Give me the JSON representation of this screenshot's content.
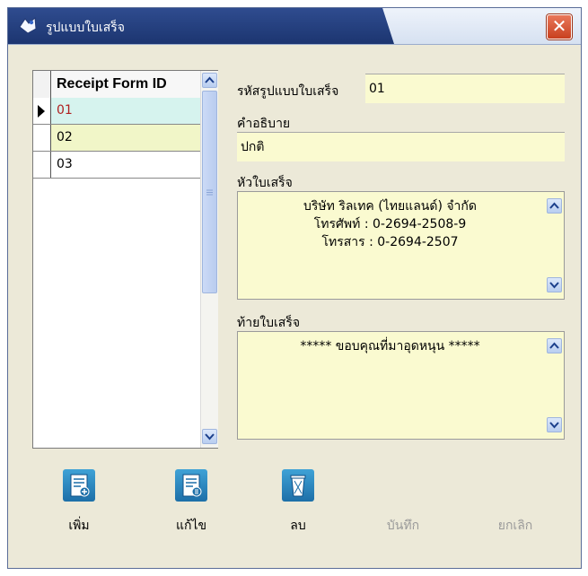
{
  "window": {
    "title": "รูปแบบใบเสร็จ"
  },
  "grid": {
    "header": "Receipt Form ID",
    "rows": [
      "01",
      "02",
      "03"
    ],
    "selected_index": 0
  },
  "form": {
    "code_label": "รหัสรูปแบบใบเสร็จ",
    "code_value": "01",
    "desc_label": "คำอธิบาย",
    "desc_value": "ปกติ",
    "header_label": "หัวใบเสร็จ",
    "header_text": "บริษัท ริลเทค (ไทยแลนด์) จำกัด\nโทรศัพท์ : 0-2694-2508-9\nโทรสาร : 0-2694-2507",
    "footer_label": "ท้ายใบเสร็จ",
    "footer_text": "***** ขอบคุณที่มาอุดหนุน *****"
  },
  "toolbar": {
    "add": "เพิ่ม",
    "edit": "แก้ไข",
    "delete": "ลบ",
    "save": "บันทึก",
    "cancel": "ยกเลิก"
  },
  "icons": {
    "close": "close-icon",
    "app": "app-icon",
    "add": "add-document-icon",
    "edit": "edit-document-icon",
    "delete": "trash-icon"
  },
  "colors": {
    "field_bg": "#fafad0",
    "selected_row": "#d6f3ee",
    "alt_row": "#f1f6c8",
    "title_bar": "#1c3570",
    "tool_icon": "#1d6fa8"
  }
}
